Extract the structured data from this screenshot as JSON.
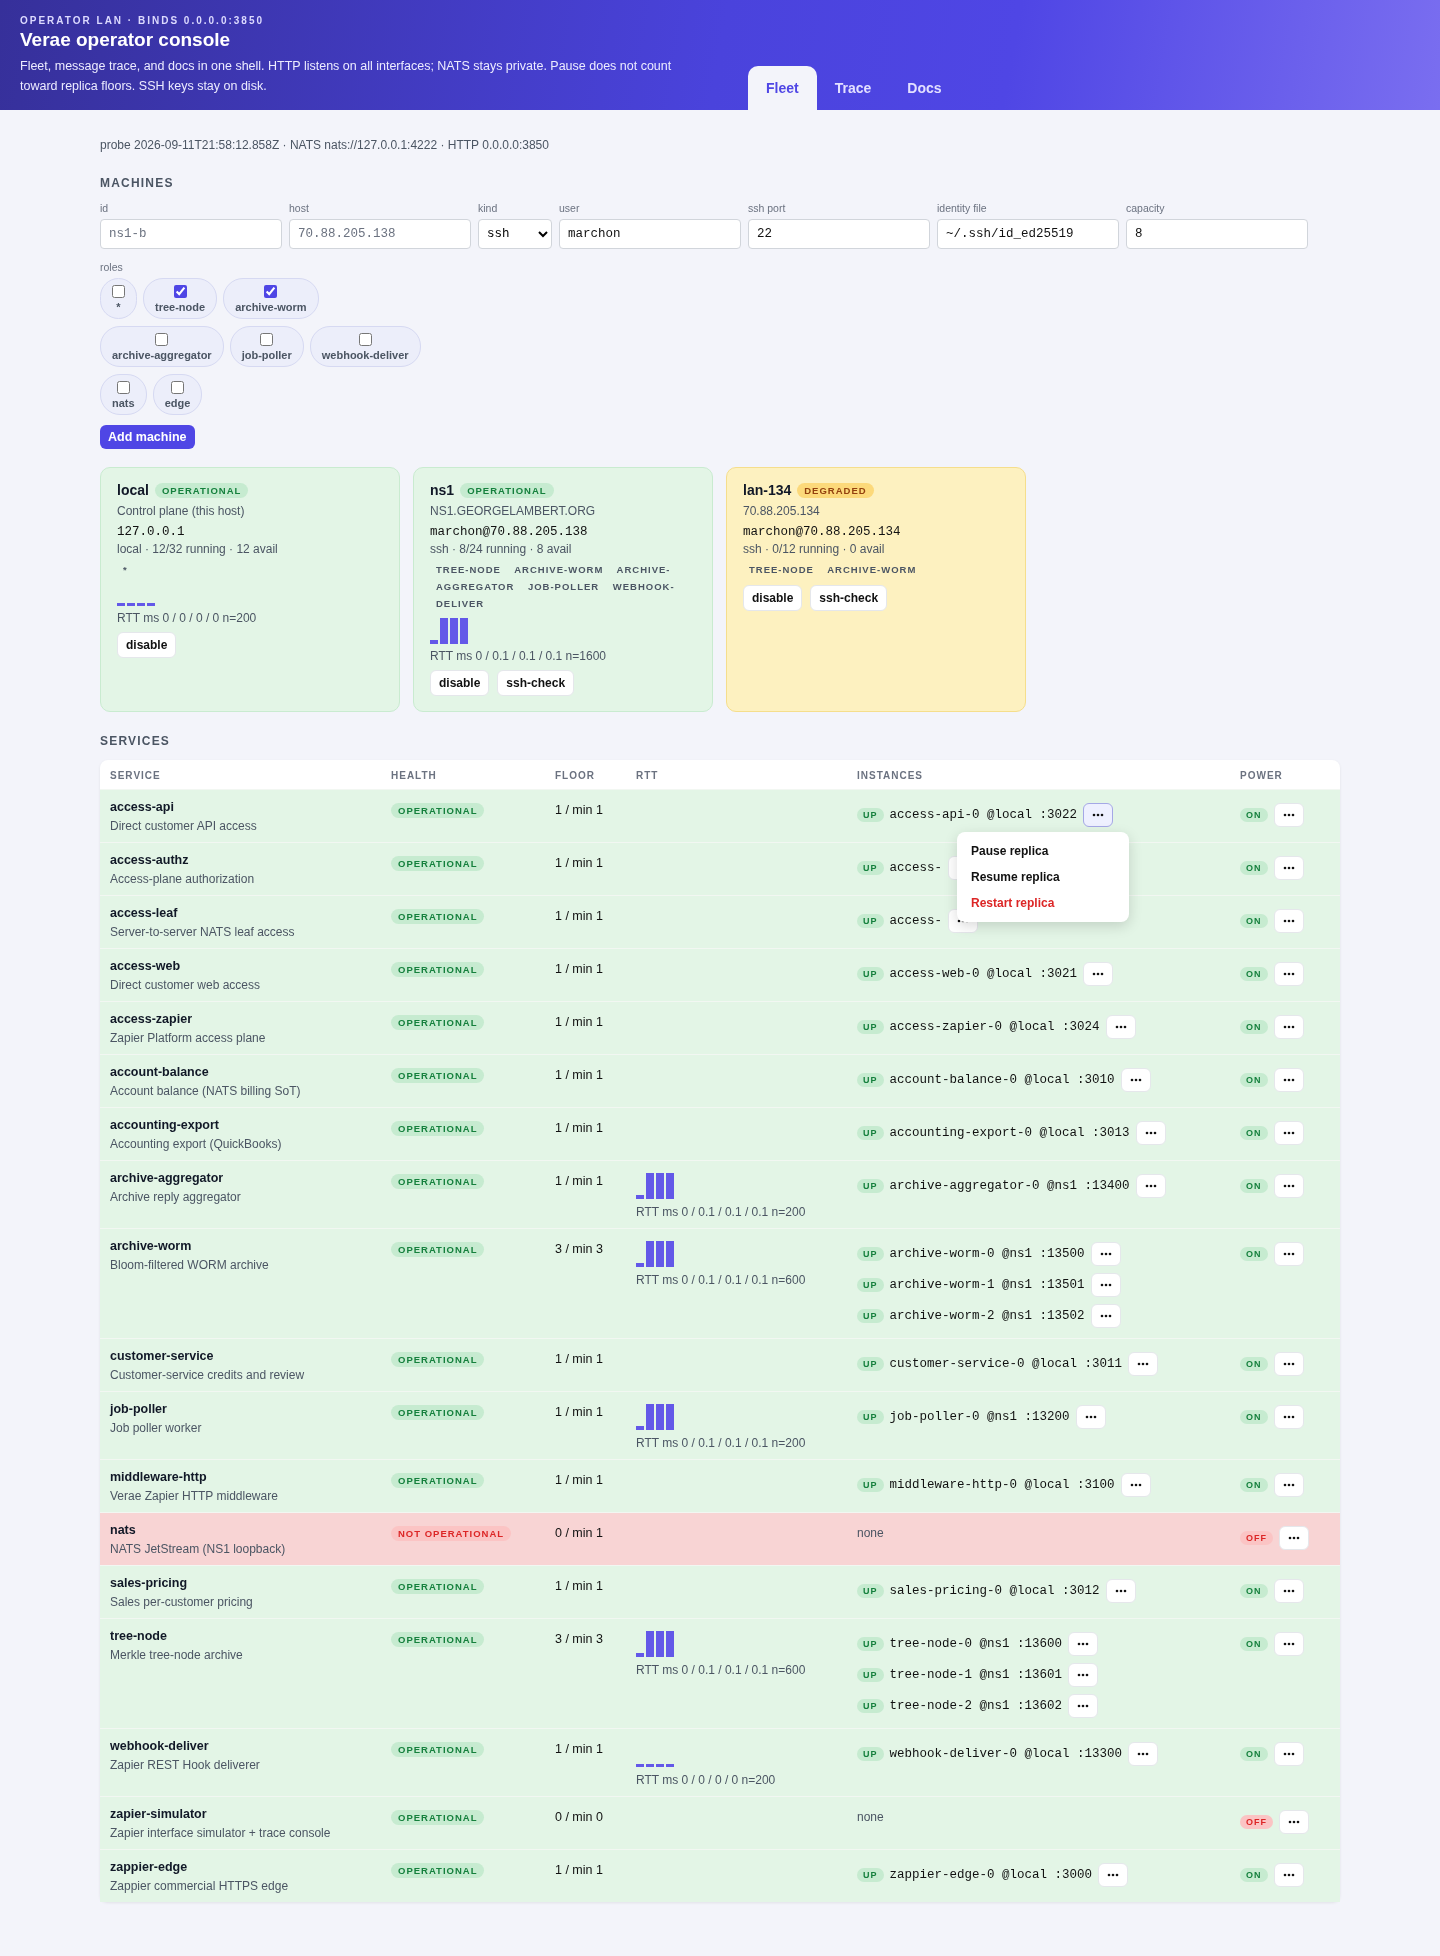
{
  "header": {
    "eyebrow": "OPERATOR LAN · BINDS 0.0.0.0:3850",
    "title": "Verae operator console",
    "description": "Fleet, message trace, and docs in one shell. HTTP listens on all interfaces; NATS stays private. Pause does not count toward replica floors. SSH keys stay on disk."
  },
  "tabs": [
    {
      "label": "Fleet",
      "selected": true
    },
    {
      "label": "Trace",
      "selected": false
    },
    {
      "label": "Docs",
      "selected": false
    }
  ],
  "probe": "probe 2026-09-11T21:58:12.858Z · NATS nats://127.0.0.1:4222 · HTTP 0.0.0.0:3850",
  "machines": {
    "heading": "MACHINES",
    "fields": [
      {
        "label": "id",
        "kind": "text",
        "placeholder": "ns1-b"
      },
      {
        "label": "host",
        "kind": "text",
        "placeholder": "70.88.205.138"
      },
      {
        "label": "kind",
        "kind": "select",
        "value": "ssh"
      },
      {
        "label": "user",
        "kind": "text",
        "value": "marchon"
      },
      {
        "label": "ssh port",
        "kind": "text",
        "value": "22"
      },
      {
        "label": "identity file",
        "kind": "text",
        "value": "~/.ssh/id_ed25519"
      },
      {
        "label": "capacity",
        "kind": "text",
        "value": "8"
      }
    ],
    "roles_label": "roles",
    "roles": [
      {
        "label": "*",
        "checked": false
      },
      {
        "label": "tree-node",
        "checked": true
      },
      {
        "label": "archive-worm",
        "checked": true
      },
      {
        "label": "archive-aggregator",
        "checked": false
      },
      {
        "label": "job-poller",
        "checked": false
      },
      {
        "label": "webhook-deliver",
        "checked": false
      },
      {
        "label": "nats",
        "checked": false
      },
      {
        "label": "edge",
        "checked": false
      }
    ],
    "submit": "Add machine",
    "cards": [
      {
        "name": "local",
        "status": {
          "label": "OPERATIONAL",
          "kind": "ok"
        },
        "subtitle": "Control plane (this host)",
        "address": "127.0.0.1",
        "stats": "local · 12/32 running · 12 avail",
        "roles": [
          "*"
        ],
        "sparkline": {
          "kind": "flat"
        },
        "rtt": "RTT ms 0 / 0 / 0 / 0 n=200",
        "actions": [
          "disable"
        ]
      },
      {
        "name": "ns1",
        "status": {
          "label": "OPERATIONAL",
          "kind": "ok"
        },
        "subtitle": "NS1.GEORGELAMBERT.ORG",
        "address": "marchon@70.88.205.138",
        "stats": "ssh · 8/24 running · 8 avail",
        "roles": [
          "TREE-NODE",
          "ARCHIVE-WORM",
          "ARCHIVE-AGGREGATOR",
          "JOB-POLLER",
          "WEBHOOK-DELIVER"
        ],
        "sparkline": {
          "kind": "step"
        },
        "rtt": "RTT ms 0 / 0.1 / 0.1 / 0.1 n=1600",
        "actions": [
          "disable",
          "ssh-check"
        ]
      },
      {
        "name": "lan-134",
        "status": {
          "label": "DEGRADED",
          "kind": "degraded"
        },
        "subtitle": "70.88.205.134",
        "address": "marchon@70.88.205.134",
        "stats": "ssh · 0/12 running · 0 avail",
        "roles": [
          "TREE-NODE",
          "ARCHIVE-WORM"
        ],
        "actions": [
          "disable",
          "ssh-check"
        ]
      }
    ]
  },
  "services": {
    "heading": "SERVICES",
    "columns": [
      "SERVICE",
      "HEALTH",
      "FLOOR",
      "RTT",
      "INSTANCES",
      "POWER"
    ],
    "menu_items": [
      {
        "label": "Pause replica",
        "kind": "normal"
      },
      {
        "label": "Resume replica",
        "kind": "normal"
      },
      {
        "label": "Restart replica",
        "kind": "danger"
      }
    ],
    "rows": [
      {
        "name": "access-api",
        "description": "Direct customer API access",
        "health": {
          "label": "OPERATIONAL",
          "ok": true
        },
        "floor": "1 / min 1",
        "instances": [
          {
            "state": "UP",
            "label": "access-api-0 @local :3022",
            "menu_open": true
          }
        ],
        "power": {
          "label": "ON",
          "on": true
        }
      },
      {
        "name": "access-authz",
        "description": "Access-plane authorization",
        "health": {
          "label": "OPERATIONAL",
          "ok": true
        },
        "floor": "1 / min 1",
        "instances": [
          {
            "state": "UP",
            "label": "access-",
            "menu_open": false
          }
        ],
        "power": {
          "label": "ON",
          "on": true
        }
      },
      {
        "name": "access-leaf",
        "description": "Server-to-server NATS leaf access",
        "health": {
          "label": "OPERATIONAL",
          "ok": true
        },
        "floor": "1 / min 1",
        "instances": [
          {
            "state": "UP",
            "label": "access-",
            "menu_open": false
          }
        ],
        "power": {
          "label": "ON",
          "on": true
        }
      },
      {
        "name": "access-web",
        "description": "Direct customer web access",
        "health": {
          "label": "OPERATIONAL",
          "ok": true
        },
        "floor": "1 / min 1",
        "instances": [
          {
            "state": "UP",
            "label": "access-web-0 @local :3021",
            "menu_open": false
          }
        ],
        "power": {
          "label": "ON",
          "on": true
        }
      },
      {
        "name": "access-zapier",
        "description": "Zapier Platform access plane",
        "health": {
          "label": "OPERATIONAL",
          "ok": true
        },
        "floor": "1 / min 1",
        "instances": [
          {
            "state": "UP",
            "label": "access-zapier-0 @local :3024",
            "menu_open": false
          }
        ],
        "power": {
          "label": "ON",
          "on": true
        }
      },
      {
        "name": "account-balance",
        "description": "Account balance (NATS billing SoT)",
        "health": {
          "label": "OPERATIONAL",
          "ok": true
        },
        "floor": "1 / min 1",
        "instances": [
          {
            "state": "UP",
            "label": "account-balance-0 @local :3010",
            "menu_open": false
          }
        ],
        "power": {
          "label": "ON",
          "on": true
        }
      },
      {
        "name": "accounting-export",
        "description": "Accounting export (QuickBooks)",
        "health": {
          "label": "OPERATIONAL",
          "ok": true
        },
        "floor": "1 / min 1",
        "instances": [
          {
            "state": "UP",
            "label": "accounting-export-0 @local :3013",
            "menu_open": false
          }
        ],
        "power": {
          "label": "ON",
          "on": true
        }
      },
      {
        "name": "archive-aggregator",
        "description": "Archive reply aggregator",
        "health": {
          "label": "OPERATIONAL",
          "ok": true
        },
        "floor": "1 / min 1",
        "sparkline": {
          "kind": "step"
        },
        "rtt": "RTT ms 0 / 0.1 / 0.1 / 0.1 n=200",
        "instances": [
          {
            "state": "UP",
            "label": "archive-aggregator-0 @ns1 :13400",
            "menu_open": false
          }
        ],
        "power": {
          "label": "ON",
          "on": true
        }
      },
      {
        "name": "archive-worm",
        "description": "Bloom-filtered WORM archive",
        "health": {
          "label": "OPERATIONAL",
          "ok": true
        },
        "floor": "3 / min 3",
        "sparkline": {
          "kind": "step"
        },
        "rtt": "RTT ms 0 / 0.1 / 0.1 / 0.1 n=600",
        "instances": [
          {
            "state": "UP",
            "label": "archive-worm-0 @ns1 :13500",
            "menu_open": false
          },
          {
            "state": "UP",
            "label": "archive-worm-1 @ns1 :13501",
            "menu_open": false
          },
          {
            "state": "UP",
            "label": "archive-worm-2 @ns1 :13502",
            "menu_open": false
          }
        ],
        "power": {
          "label": "ON",
          "on": true
        }
      },
      {
        "name": "customer-service",
        "description": "Customer-service credits and review",
        "health": {
          "label": "OPERATIONAL",
          "ok": true
        },
        "floor": "1 / min 1",
        "instances": [
          {
            "state": "UP",
            "label": "customer-service-0 @local :3011",
            "menu_open": false
          }
        ],
        "power": {
          "label": "ON",
          "on": true
        }
      },
      {
        "name": "job-poller",
        "description": "Job poller worker",
        "health": {
          "label": "OPERATIONAL",
          "ok": true
        },
        "floor": "1 / min 1",
        "sparkline": {
          "kind": "step"
        },
        "rtt": "RTT ms 0 / 0.1 / 0.1 / 0.1 n=200",
        "instances": [
          {
            "state": "UP",
            "label": "job-poller-0 @ns1 :13200",
            "menu_open": false
          }
        ],
        "power": {
          "label": "ON",
          "on": true
        }
      },
      {
        "name": "middleware-http",
        "description": "Verae Zapier HTTP middleware",
        "health": {
          "label": "OPERATIONAL",
          "ok": true
        },
        "floor": "1 / min 1",
        "instances": [
          {
            "state": "UP",
            "label": "middleware-http-0 @local :3100",
            "menu_open": false
          }
        ],
        "power": {
          "label": "ON",
          "on": true
        }
      },
      {
        "name": "nats",
        "description": "NATS JetStream (NS1 loopback)",
        "health": {
          "label": "NOT OPERATIONAL",
          "ok": false
        },
        "floor": "0 / min 1",
        "note": "none",
        "power": {
          "label": "OFF",
          "on": false
        }
      },
      {
        "name": "sales-pricing",
        "description": "Sales per-customer pricing",
        "health": {
          "label": "OPERATIONAL",
          "ok": true
        },
        "floor": "1 / min 1",
        "instances": [
          {
            "state": "UP",
            "label": "sales-pricing-0 @local :3012",
            "menu_open": false
          }
        ],
        "power": {
          "label": "ON",
          "on": true
        }
      },
      {
        "name": "tree-node",
        "description": "Merkle tree-node archive",
        "health": {
          "label": "OPERATIONAL",
          "ok": true
        },
        "floor": "3 / min 3",
        "sparkline": {
          "kind": "step"
        },
        "rtt": "RTT ms 0 / 0.1 / 0.1 / 0.1 n=600",
        "instances": [
          {
            "state": "UP",
            "label": "tree-node-0 @ns1 :13600",
            "menu_open": false
          },
          {
            "state": "UP",
            "label": "tree-node-1 @ns1 :13601",
            "menu_open": false
          },
          {
            "state": "UP",
            "label": "tree-node-2 @ns1 :13602",
            "menu_open": false
          }
        ],
        "power": {
          "label": "ON",
          "on": true
        }
      },
      {
        "name": "webhook-deliver",
        "description": "Zapier REST Hook deliverer",
        "health": {
          "label": "OPERATIONAL",
          "ok": true
        },
        "floor": "1 / min 1",
        "sparkline": {
          "kind": "flat"
        },
        "rtt": "RTT ms 0 / 0 / 0 / 0 n=200",
        "instances": [
          {
            "state": "UP",
            "label": "webhook-deliver-0 @local :13300",
            "menu_open": false
          }
        ],
        "power": {
          "label": "ON",
          "on": true
        }
      },
      {
        "name": "zapier-simulator",
        "description": "Zapier interface simulator + trace console",
        "health": {
          "label": "OPERATIONAL",
          "ok": true
        },
        "floor": "0 / min 0",
        "note": "none",
        "power": {
          "label": "OFF",
          "on": false
        }
      },
      {
        "name": "zappier-edge",
        "description": "Zappier commercial HTTPS edge",
        "health": {
          "label": "OPERATIONAL",
          "ok": true
        },
        "floor": "1 / min 1",
        "instances": [
          {
            "state": "UP",
            "label": "zappier-edge-0 @local :3000",
            "menu_open": false
          }
        ],
        "power": {
          "label": "ON",
          "on": true
        }
      }
    ]
  }
}
